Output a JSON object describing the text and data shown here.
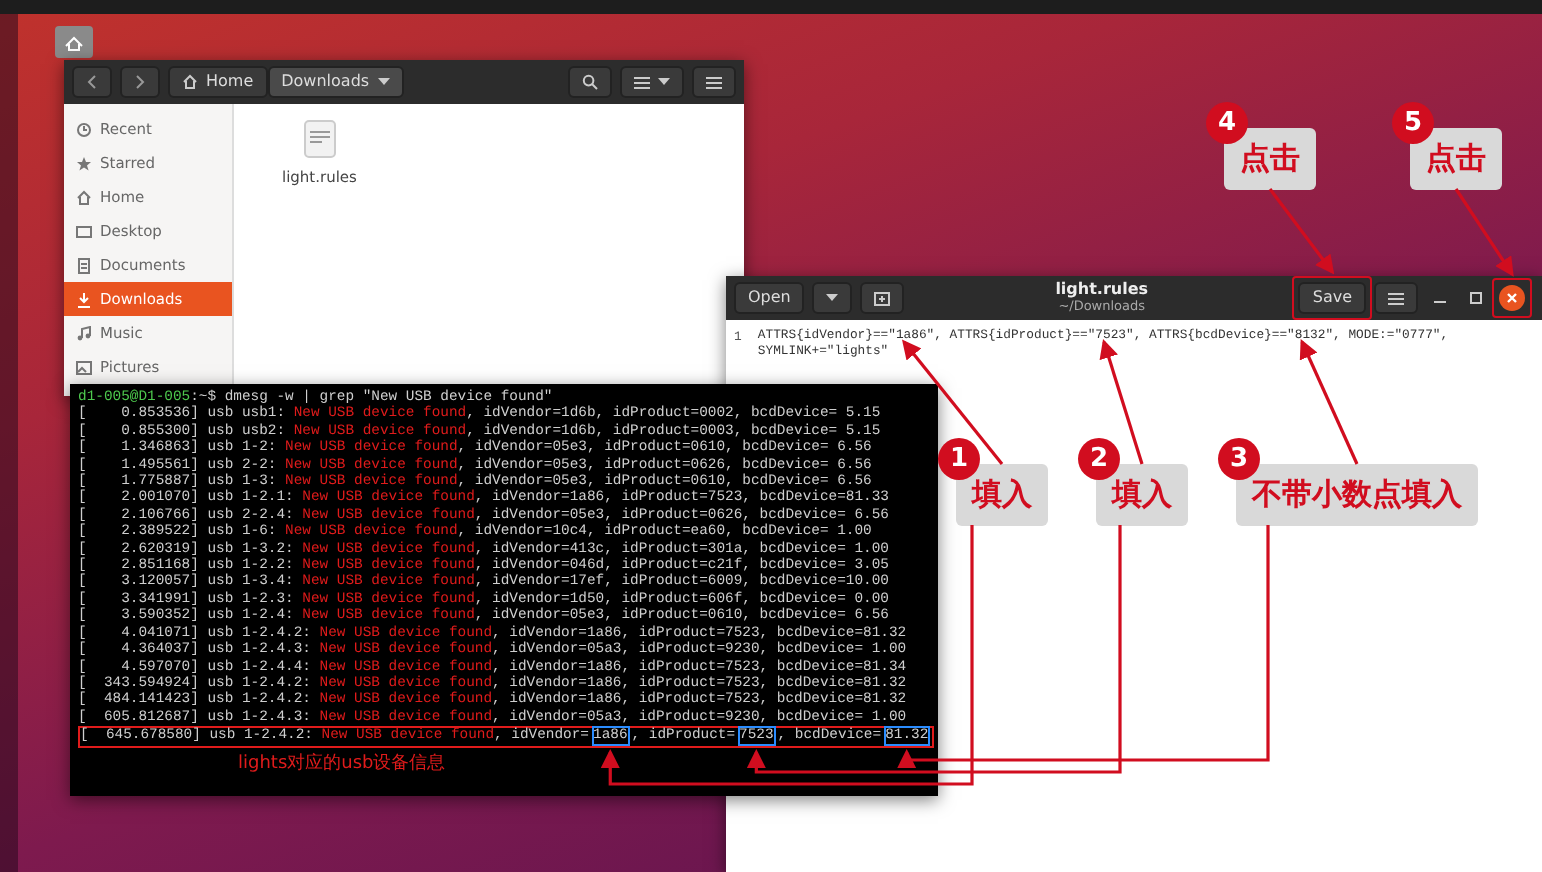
{
  "files_window": {
    "path": [
      {
        "label": "Home",
        "selected": false
      },
      {
        "label": "Downloads",
        "selected": true
      }
    ],
    "sidebar": [
      {
        "label": "Recent",
        "selected": false
      },
      {
        "label": "Starred",
        "selected": false
      },
      {
        "label": "Home",
        "selected": false
      },
      {
        "label": "Desktop",
        "selected": false
      },
      {
        "label": "Documents",
        "selected": false
      },
      {
        "label": "Downloads",
        "selected": true
      },
      {
        "label": "Music",
        "selected": false
      },
      {
        "label": "Pictures",
        "selected": false
      }
    ],
    "files": [
      {
        "name": "light.rules"
      }
    ]
  },
  "editor": {
    "open_label": "Open",
    "title": "light.rules",
    "subtitle": "~/Downloads",
    "save_label": "Save",
    "line_number": "1",
    "content": "ATTRS{idVendor}==\"1a86\", ATTRS{idProduct}==\"7523\", ATTRS{bcdDevice}==\"8132\", MODE:=\"0777\", SYMLINK+=\"lights\""
  },
  "terminal": {
    "prompt": "d1-005@D1-005",
    "prompt_tail": ":~$ dmesg -w | grep \"New USB device found\"",
    "lines": [
      {
        "prefix": "[    0.853536] usb usb1: ",
        "message": "New USB device found",
        "rest": ", idVendor=1d6b, idProduct=0002, bcdDevice= 5.15"
      },
      {
        "prefix": "[    0.855300] usb usb2: ",
        "message": "New USB device found",
        "rest": ", idVendor=1d6b, idProduct=0003, bcdDevice= 5.15"
      },
      {
        "prefix": "[    1.346863] usb 1-2: ",
        "message": "New USB device found",
        "rest": ", idVendor=05e3, idProduct=0610, bcdDevice= 6.56"
      },
      {
        "prefix": "[    1.495561] usb 2-2: ",
        "message": "New USB device found",
        "rest": ", idVendor=05e3, idProduct=0626, bcdDevice= 6.56"
      },
      {
        "prefix": "[    1.775887] usb 1-3: ",
        "message": "New USB device found",
        "rest": ", idVendor=05e3, idProduct=0610, bcdDevice= 6.56"
      },
      {
        "prefix": "[    2.001070] usb 1-2.1: ",
        "message": "New USB device found",
        "rest": ", idVendor=1a86, idProduct=7523, bcdDevice=81.33"
      },
      {
        "prefix": "[    2.106766] usb 2-2.4: ",
        "message": "New USB device found",
        "rest": ", idVendor=05e3, idProduct=0626, bcdDevice= 6.56"
      },
      {
        "prefix": "[    2.389522] usb 1-6: ",
        "message": "New USB device found",
        "rest": ", idVendor=10c4, idProduct=ea60, bcdDevice= 1.00"
      },
      {
        "prefix": "[    2.620319] usb 1-3.2: ",
        "message": "New USB device found",
        "rest": ", idVendor=413c, idProduct=301a, bcdDevice= 1.00"
      },
      {
        "prefix": "[    2.851168] usb 1-2.2: ",
        "message": "New USB device found",
        "rest": ", idVendor=046d, idProduct=c21f, bcdDevice= 3.05"
      },
      {
        "prefix": "[    3.120057] usb 1-3.4: ",
        "message": "New USB device found",
        "rest": ", idVendor=17ef, idProduct=6009, bcdDevice=10.00"
      },
      {
        "prefix": "[    3.341991] usb 1-2.3: ",
        "message": "New USB device found",
        "rest": ", idVendor=1d50, idProduct=606f, bcdDevice= 0.00"
      },
      {
        "prefix": "[    3.590352] usb 1-2.4: ",
        "message": "New USB device found",
        "rest": ", idVendor=05e3, idProduct=0610, bcdDevice= 6.56"
      },
      {
        "prefix": "[    4.041071] usb 1-2.4.2: ",
        "message": "New USB device found",
        "rest": ", idVendor=1a86, idProduct=7523, bcdDevice=81.32"
      },
      {
        "prefix": "[    4.364037] usb 1-2.4.3: ",
        "message": "New USB device found",
        "rest": ", idVendor=05a3, idProduct=9230, bcdDevice= 1.00"
      },
      {
        "prefix": "[    4.597070] usb 1-2.4.4: ",
        "message": "New USB device found",
        "rest": ", idVendor=1a86, idProduct=7523, bcdDevice=81.34"
      },
      {
        "prefix": "[  343.594924] usb 1-2.4.2: ",
        "message": "New USB device found",
        "rest": ", idVendor=1a86, idProduct=7523, bcdDevice=81.32"
      },
      {
        "prefix": "[  484.141423] usb 1-2.4.2: ",
        "message": "New USB device found",
        "rest": ", idVendor=1a86, idProduct=7523, bcdDevice=81.32"
      },
      {
        "prefix": "[  605.812687] usb 1-2.4.3: ",
        "message": "New USB device found",
        "rest": ", idVendor=05a3, idProduct=9230, bcdDevice= 1.00"
      }
    ],
    "highlighted_line": {
      "prefix": "[  645.678580] usb 1-2.4.2: ",
      "message": "New USB device found",
      "parts": [
        {
          "text": ", idVendor=",
          "boxed": false
        },
        {
          "text": "1a86",
          "boxed": true
        },
        {
          "text": ", idProduct=",
          "boxed": false
        },
        {
          "text": "7523",
          "boxed": true
        },
        {
          "text": ", bcdDevice=",
          "boxed": false
        },
        {
          "text": "81.32",
          "boxed": true
        }
      ]
    },
    "caption": "lights对应的usb设备信息"
  },
  "callouts": [
    {
      "number": "4",
      "label": "点击"
    },
    {
      "number": "5",
      "label": "点击"
    },
    {
      "number": "1",
      "label": "填入"
    },
    {
      "number": "2",
      "label": "填入"
    },
    {
      "number": "3",
      "label": "不带小数点填入"
    }
  ]
}
